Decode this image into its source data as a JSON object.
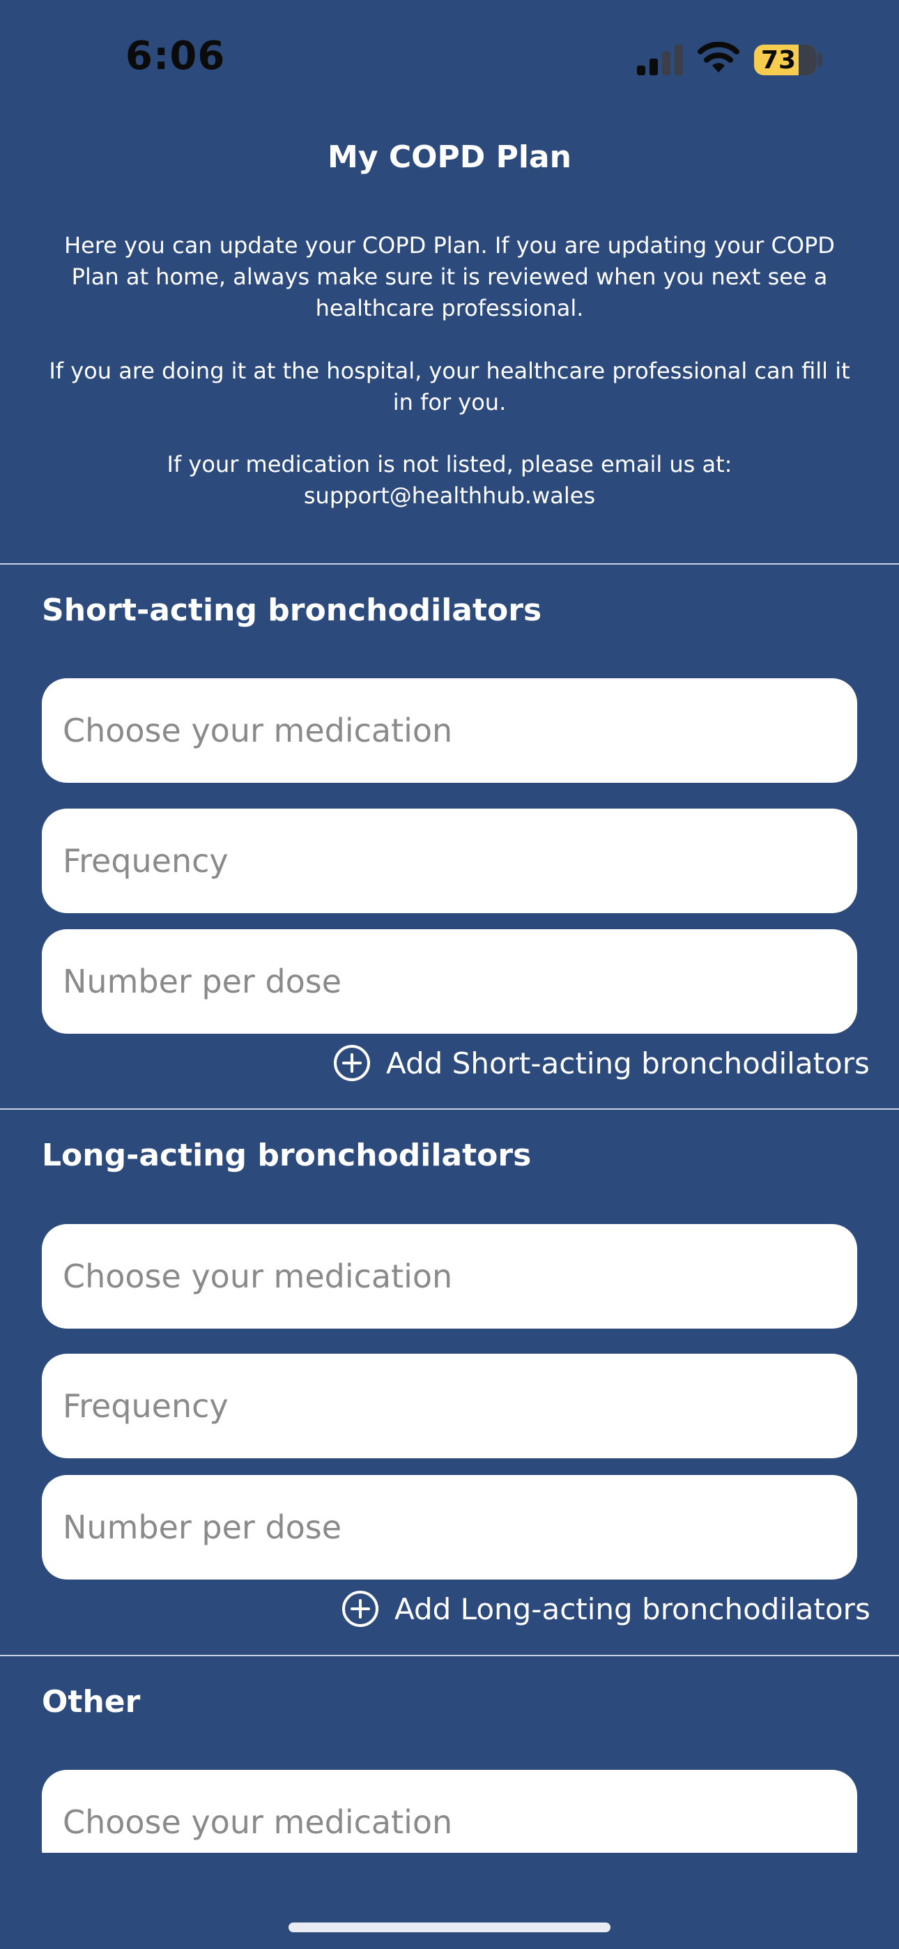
{
  "status_bar": {
    "time": "6:06",
    "battery": "73",
    "icons": [
      "cellular-signal-icon",
      "wifi-icon",
      "battery-icon"
    ]
  },
  "header": {
    "title": "My COPD Plan",
    "intro_1": "Here you can update your COPD Plan. If you are updating your COPD Plan at home, always make sure it is reviewed when you next see a healthcare professional.",
    "intro_2": "If you are doing it at the hospital, your healthcare professional can fill it in for you.",
    "intro_3": "If your medication is not listed, please email us at: support@healthhub.wales"
  },
  "sections": [
    {
      "title": "Short-acting bronchodilators",
      "medication_placeholder": "Choose your medication",
      "frequency_placeholder": "Frequency",
      "dose_placeholder": "Number per dose",
      "add_label": "Add Short-acting bronchodilators"
    },
    {
      "title": "Long-acting bronchodilators",
      "medication_placeholder": "Choose your medication",
      "frequency_placeholder": "Frequency",
      "dose_placeholder": "Number per dose",
      "add_label": "Add Long-acting bronchodilators"
    },
    {
      "title": "Other",
      "medication_placeholder": "Choose your medication"
    }
  ],
  "colors": {
    "background": "#2c4a7c",
    "field_background": "#ffffff",
    "placeholder_text": "#8a8a8a",
    "battery": "#f6cd4e"
  }
}
